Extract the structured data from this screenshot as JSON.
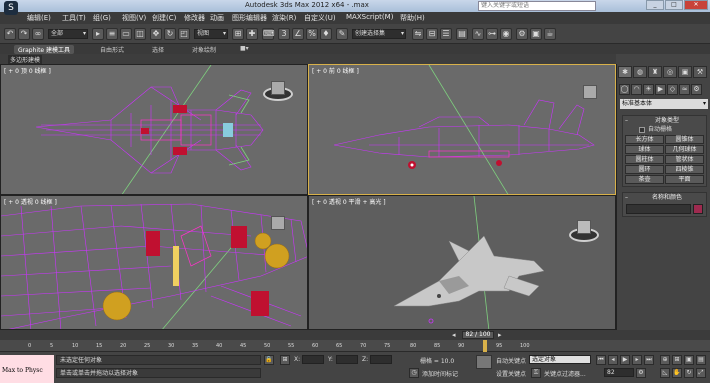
{
  "window": {
    "title": "Autodesk 3ds Max 2012 x64  -  .max",
    "search_placeholder": "键入关键字或短语",
    "minimize": "_",
    "maximize": "□",
    "close": "✕"
  },
  "menu": [
    "编辑(E)",
    "工具(T)",
    "组(G)",
    "视图(V)",
    "创建(C)",
    "修改器",
    "动画",
    "图形编辑器",
    "渲染(R)",
    "自定义(U)",
    "MAXScript(M)",
    "帮助(H)"
  ],
  "toolbar": {
    "selection_filter": "全部",
    "reference_coord": "视图",
    "named_selection": "创建选择集",
    "icons": [
      "undo-icon",
      "redo-icon",
      "select-link-icon",
      "unlink-icon",
      "bind-space-warp-icon",
      "select-object-icon",
      "select-by-name-icon",
      "rectangle-select-icon",
      "window-crossing-icon",
      "select-move-icon",
      "select-rotate-icon",
      "select-scale-icon",
      "pivot-icon",
      "select-manipulate-icon",
      "keyboard-shortcut-icon",
      "snap-3d-icon",
      "angle-snap-icon",
      "percent-snap-icon",
      "spinner-snap-icon",
      "edit-named-selection-icon",
      "mirror-icon",
      "align-icon",
      "layer-manager-icon",
      "graphite-toggle-icon",
      "curve-editor-icon",
      "schematic-view-icon",
      "material-editor-icon",
      "render-setup-icon",
      "rendered-frame-icon",
      "render-icon"
    ]
  },
  "ribbon": {
    "tabs": [
      "Graphite 建模工具",
      "自由形式",
      "选择",
      "对象绘制"
    ],
    "active_panel": "多边形建模"
  },
  "viewports": [
    {
      "label": "[ + 0 顶 0 线框 ]"
    },
    {
      "label": "[ + 0 前 0 线框 ]"
    },
    {
      "label": "[ + 0 透视 0 线框 ]"
    },
    {
      "label": "[ + 0 透视 0 平滑 + 高光 ]"
    }
  ],
  "command_panel": {
    "tabs": [
      "create-tab-icon",
      "modify-tab-icon",
      "hierarchy-tab-icon",
      "motion-tab-icon",
      "display-tab-icon",
      "utilities-tab-icon"
    ],
    "category": "标准基本体",
    "object_type_title": "对象类型",
    "autogrid": "自动栅格",
    "objects": [
      "长方体",
      "圆锥体",
      "球体",
      "几何球体",
      "圆柱体",
      "管状体",
      "圆环",
      "四棱锥",
      "茶壶",
      "平面"
    ],
    "name_color_title": "名称和颜色",
    "object_color": "#9e2a4f"
  },
  "timeline": {
    "frame_display": "82 / 100",
    "ticks": [
      "0",
      "5",
      "10",
      "15",
      "20",
      "25",
      "30",
      "35",
      "40",
      "45",
      "50",
      "55",
      "60",
      "65",
      "70",
      "75",
      "80",
      "85",
      "90",
      "95",
      "100"
    ],
    "current_frame": 82
  },
  "status": {
    "maxscript_label": "Max to Physc",
    "selection_status": "未选定任何对象",
    "prompt": "单击或单击并拖动以选择对象",
    "grid": "栅格 = 10.0",
    "add_time_tag": "添加时间标记",
    "auto_key": "自动关键点",
    "set_key": "设置关键点",
    "key_mode": "选定对象",
    "key_filters": "关键点过滤器...",
    "frame_field": "82"
  },
  "colors": {
    "wireframe": "#cc33ff",
    "highlight_wire": "#ff33cc",
    "active_viewport_border": "#d8b14a",
    "viewport_bg": "#6a6a6a"
  }
}
